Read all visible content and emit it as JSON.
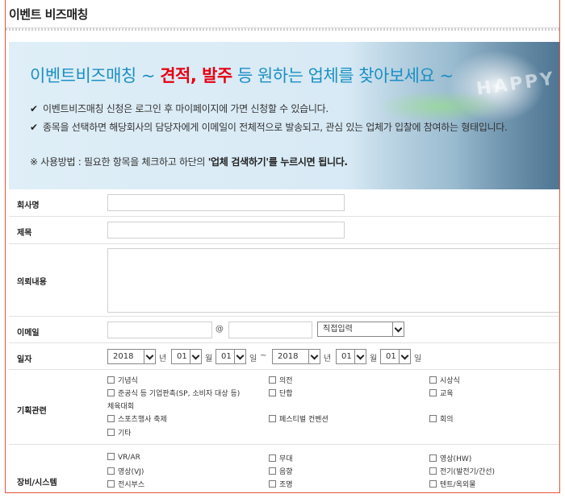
{
  "page": {
    "title": "이벤트 비즈매칭"
  },
  "banner": {
    "headline_pre": "이벤트비즈매칭 ~ ",
    "headline_highlight": "견적, 발주",
    "headline_post": " 등 원하는 업체를 찾아보세요 ~",
    "bullets": [
      "이벤트비즈매칭 신청은 로그인 후 마이페이지에 가면 신청할 수 있습니다.",
      "종목을 선택하면 해당회사의 담당자에게 이메일이 전체적으로 발송되고, 관심 있는 업체가 입찰에 참여하는 형태입니다."
    ],
    "note_pre": "※ 사용방법 : 필요한 항목을 체크하고 하단의 ",
    "note_bold": "'업체 검색하기'를 누르시면 됩니다.",
    "stage_text": "HAPPY"
  },
  "form": {
    "company_label": "회사명",
    "subject_label": "제목",
    "request_label": "의뢰내용",
    "email_label": "이메일",
    "email_at": "@",
    "email_domain_select": "직접입력",
    "date_label": "일자",
    "date_start": {
      "year": "2018",
      "year_unit": "년",
      "month": "01",
      "month_unit": "월",
      "day": "01",
      "day_unit": "일"
    },
    "date_tilde": "~",
    "date_end": {
      "year": "2018",
      "year_unit": "년",
      "month": "01",
      "month_unit": "월",
      "day": "01",
      "day_unit": "일"
    },
    "planning_label": "기획관련",
    "planning_options": {
      "r1c1": "기념식",
      "r1c2": "의전",
      "r1c3": "시상식",
      "r2c1": "준공식 등 기업판촉(SP, 소비자 대상 등)",
      "r2c2": "단합",
      "r2c3": "교육",
      "r3c1": "체육대회",
      "r4c1": "스포츠행사 축제",
      "r4c2": "페스티벌 컨벤션",
      "r4c3": "회의",
      "r5c1": "기타"
    },
    "equipment_label": "장비/시스템",
    "equipment_options": {
      "r1c1": "VR/AR",
      "r1c2": "무대",
      "r1c3": "영상(HW)",
      "r2c1": "영상(VJ)",
      "r2c2": "음향",
      "r2c3": "전기(발전기/간선)",
      "r3c1": "전시부스",
      "r3c2": "조명",
      "r3c3": "텐트/옥외물"
    }
  }
}
